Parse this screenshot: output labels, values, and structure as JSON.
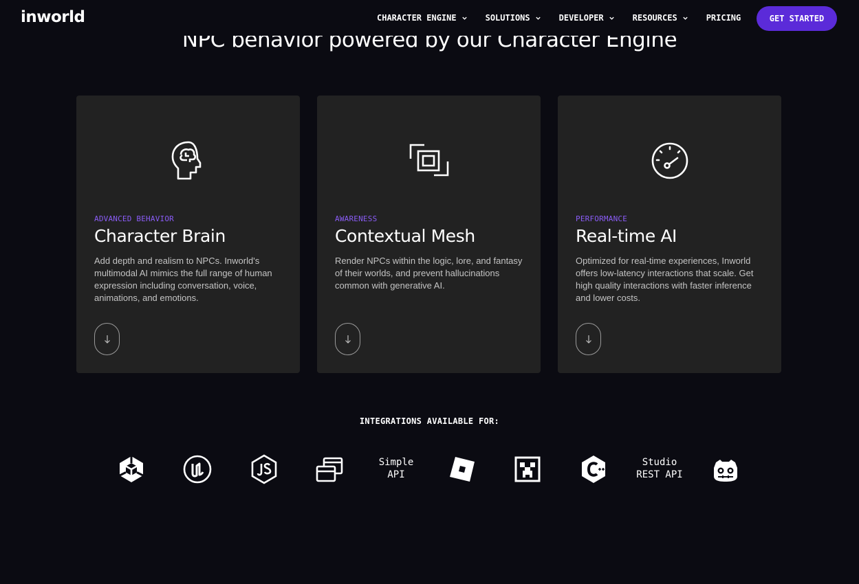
{
  "header": {
    "logo": "inworld",
    "nav": [
      {
        "label": "CHARACTER ENGINE"
      },
      {
        "label": "SOLUTIONS"
      },
      {
        "label": "DEVELOPER"
      },
      {
        "label": "RESOURCES"
      },
      {
        "label": "PRICING"
      }
    ],
    "cta_label": "GET STARTED"
  },
  "section": {
    "title": "NPC behavior powered by our Character Engine"
  },
  "cards": [
    {
      "tag": "ADVANCED BEHAVIOR",
      "title": "Character Brain",
      "description": "Add depth and realism to NPCs. Inworld's multimodal AI mimics the full range of human expression including conversation, voice, animations, and emotions.",
      "icon": "brain-head-icon",
      "arrow": "↓"
    },
    {
      "tag": "AWARENESS",
      "title": "Contextual Mesh",
      "description": "Render NPCs within the logic, lore, and fantasy of their worlds, and prevent hallucinations common with generative AI.",
      "icon": "layered-squares-icon",
      "arrow": "↓"
    },
    {
      "tag": "PERFORMANCE",
      "title": "Real-time AI",
      "description": "Optimized for real-time experiences, Inworld offers low-latency interactions that scale. Get high quality interactions with faster inference and lower costs.",
      "icon": "speedometer-icon",
      "arrow": "↓"
    }
  ],
  "integrations": {
    "label": "INTEGRATIONS AVAILABLE FOR:",
    "simple_api": [
      "Simple",
      "API"
    ],
    "studio_api": [
      "Studio",
      "REST API"
    ],
    "icons": [
      "unity-icon",
      "unreal-icon",
      "nodejs-icon",
      "web-window-icon",
      "roblox-icon",
      "minecraft-icon",
      "cplusplus-icon",
      "godot-icon"
    ]
  },
  "colors": {
    "background": "#0b0b12",
    "card": "#222222",
    "accent": "#5b2bd9",
    "tag": "#8a5cf6"
  }
}
